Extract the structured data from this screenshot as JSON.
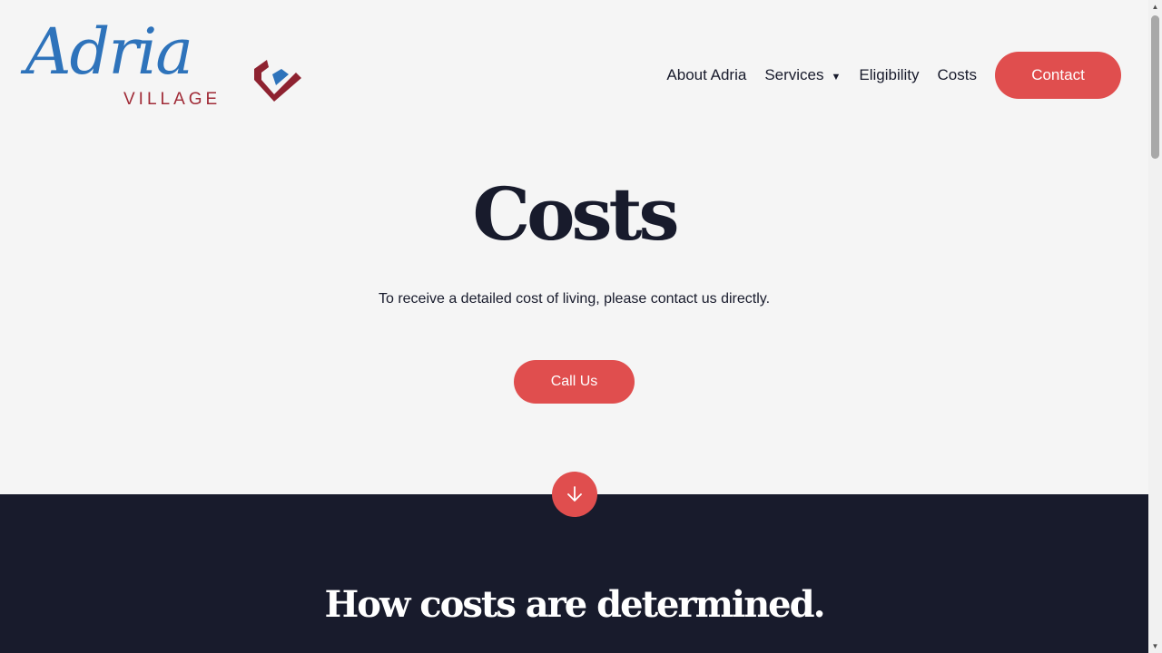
{
  "logo": {
    "script_text": "Adria",
    "sub_text": "VILLAGE"
  },
  "nav": {
    "items": [
      {
        "label": "About Adria"
      },
      {
        "label": "Services",
        "caret": "▼"
      },
      {
        "label": "Eligibility"
      },
      {
        "label": "Costs"
      }
    ],
    "contact_label": "Contact"
  },
  "hero": {
    "title": "Costs",
    "text": "To receive a detailed cost of living, please contact us directly.",
    "button_label": "Call Us"
  },
  "section": {
    "title": "How costs are determined."
  },
  "colors": {
    "accent": "#e04e4e",
    "navy": "#181b2c",
    "logo_blue": "#2e73bb",
    "logo_red": "#a02a36",
    "background": "#f5f5f5"
  },
  "icons": {
    "down_arrow": "arrow-down-icon",
    "logo_mark": "heart-chevron-icon"
  }
}
